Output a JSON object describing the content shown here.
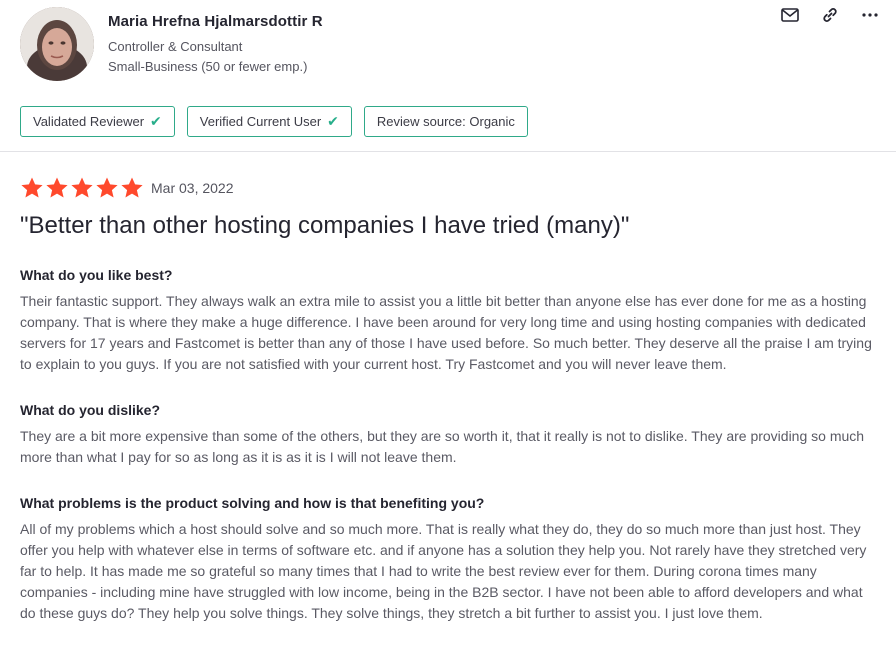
{
  "reviewer": {
    "name": "Maria Hrefna Hjalmarsdottir R",
    "role": "Controller & Consultant",
    "company_size": "Small-Business (50 or fewer emp.)"
  },
  "actions": {
    "email_icon": "envelope-icon",
    "link_icon": "link-icon",
    "more_icon": "more-horizontal-icon"
  },
  "badges": [
    {
      "label": "Validated Reviewer",
      "checked": true
    },
    {
      "label": "Verified Current User",
      "checked": true
    },
    {
      "label": "Review source: Organic",
      "checked": false
    }
  ],
  "review": {
    "rating": 5,
    "star_color": "#ff492c",
    "date": "Mar 03, 2022",
    "title": "\"Better than other hosting companies I have tried (many)\"",
    "sections": [
      {
        "question": "What do you like best?",
        "answer": "Their fantastic support. They always walk an extra mile to assist you a little bit better than anyone else has ever done for me as a hosting company. That is where they make a huge difference. I have been around for very long time and using hosting companies with dedicated servers for 17 years and Fastcomet is better than any of those I have used before. So much better. They deserve all the praise I am trying to explain to you guys. If you are not satisfied with your current host. Try Fastcomet and you will never leave them."
      },
      {
        "question": "What do you dislike?",
        "answer": "They are a bit more expensive than some of the others, but they are so worth it, that it really is not to dislike. They are providing so much more than what I pay for so as long as it is as it is I will not leave them."
      },
      {
        "question": "What problems is the product solving and how is that benefiting you?",
        "answer": "All of my problems which a host should solve and so much more. That is really what they do, they do so much more than just host. They offer you help with whatever else in terms of software etc. and if anyone has a solution they help you. Not rarely have they stretched very far to help. It has made me so grateful so many times that I had to write the best review ever for them. During corona times many companies - including mine have struggled with low income, being in the B2B sector. I have not been able to afford developers and what do these guys do? They help you solve things. They solve things, they stretch a bit further to assist you. I just love them."
      }
    ]
  },
  "colors": {
    "badge_border": "#2fa989",
    "check": "#27ae8a",
    "text_primary": "#252530",
    "text_secondary": "#5a5a64"
  }
}
